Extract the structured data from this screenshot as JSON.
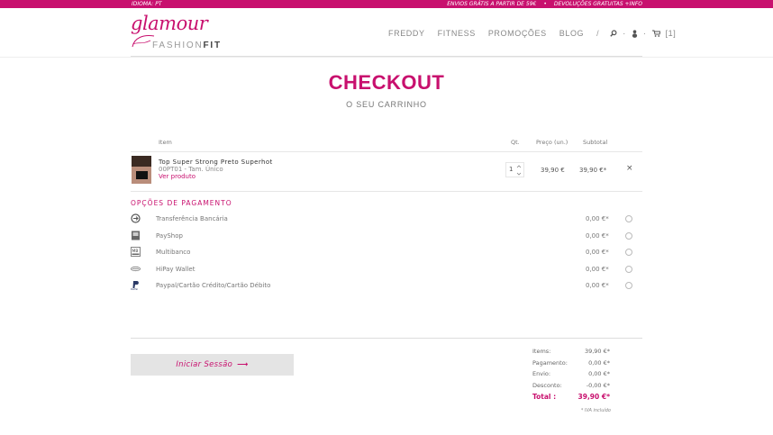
{
  "topbar": {
    "language": "IDIOMA: PT",
    "shipping": "ENVIOS GRÁTIS A PARTIR DE 59€",
    "separator": "•",
    "returns": "DEVOLUÇÕES GRATUITAS +INFO"
  },
  "logo": {
    "script": "glamour",
    "fashion": "FASHION",
    "fit": "FIT"
  },
  "nav": {
    "items": [
      "FREDDY",
      "FITNESS",
      "PROMOÇÕES",
      "BLOG"
    ],
    "divider": "/",
    "dot": "·",
    "cart_count": "[1]",
    "icons": [
      "search-icon",
      "user-icon",
      "cart-icon"
    ]
  },
  "page": {
    "title": "CHECKOUT",
    "subtitle": "O SEU CARRINHO"
  },
  "table": {
    "headers": {
      "item": "Item",
      "qty": "Qt.",
      "price": "Preço (un.)",
      "subtotal": "Subtotal"
    }
  },
  "cart_item": {
    "name": "Top Super Strong Preto Superhot",
    "ref": "00PT01 - Tam. Único",
    "view": "Ver produto",
    "qty": "1",
    "price": "39,90 €",
    "subtotal": "39,90 €*",
    "remove": "×"
  },
  "payment": {
    "title": "OPÇÕES DE PAGAMENTO",
    "options": [
      {
        "label": "Transferência Bancária",
        "value": "0,00 €*",
        "icon": "bank-transfer-icon"
      },
      {
        "label": "PayShop",
        "value": "0,00 €*",
        "icon": "payshop-icon"
      },
      {
        "label": "Multibanco",
        "value": "0,00 €*",
        "icon": "multibanco-icon"
      },
      {
        "label": "HiPay Wallet",
        "value": "0,00 €*",
        "icon": "hipay-icon"
      },
      {
        "label": "Paypal/Cartão Crédito/Cartão Débito",
        "value": "0,00 €*",
        "icon": "paypal-icon"
      }
    ]
  },
  "login": {
    "label": "Iniciar Sessão",
    "arrow": "⟶"
  },
  "summary": {
    "rows": [
      {
        "key": "Items:",
        "value": "39,90 €*"
      },
      {
        "key": "Pagamento:",
        "value": "0,00 €*"
      },
      {
        "key": "Envio:",
        "value": "0,00 €*"
      },
      {
        "key": "Desconto:",
        "value": "-0,00 €*"
      }
    ],
    "total_key": "Total :",
    "total_value": "39,90 €*",
    "iva": "* IVA incluído"
  },
  "colors": {
    "accent": "#c8106e"
  }
}
